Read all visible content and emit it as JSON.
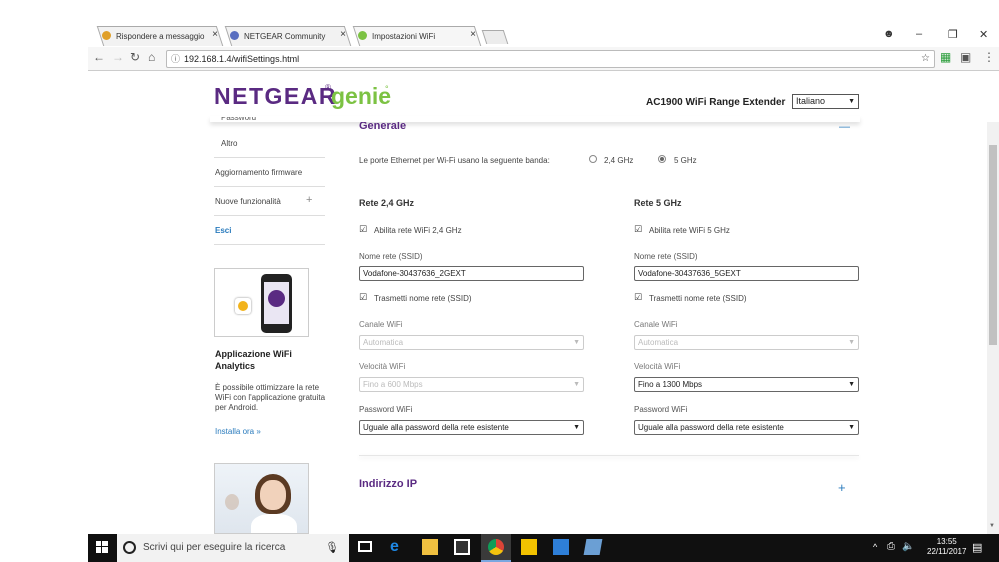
{
  "browser": {
    "tabs": [
      {
        "label": "Rispondere a messaggio",
        "favcolor": "#e0a02a"
      },
      {
        "label": "NETGEAR Community",
        "favcolor": "#5a6fc0"
      },
      {
        "label": "Impostazioni WiFi",
        "favcolor": "#7cc243"
      }
    ],
    "url": "192.168.1.4/wifiSettings.html"
  },
  "header": {
    "logo_brand": "NETGEAR",
    "logo_reg": "®",
    "logo_product": "genie",
    "logo_dot": "°",
    "model": "AC1900 WiFi Range Extender",
    "language": "Italiano"
  },
  "sidebar": {
    "cut_item": "Password",
    "items": [
      {
        "label": "Altro"
      },
      {
        "label": "Aggiornamento firmware"
      },
      {
        "label": "Nuove funzionalità"
      },
      {
        "label": "Esci"
      }
    ],
    "promo": {
      "title": "Applicazione WiFi Analytics",
      "body": "È possibile ottimizzare la rete WiFi con l'applicazione gratuita per Android.",
      "link": "Installa ora »"
    }
  },
  "main": {
    "general_title": "Generale",
    "collapse_symbol": "—",
    "ethernet_label": "Le porte Ethernet per Wi-Fi usano la seguente banda:",
    "band_options": [
      "2,4 GHz",
      "5 GHz"
    ],
    "band_selected": "5 GHz",
    "band24": {
      "title": "Rete 2,4 GHz",
      "enable_label": "Abilita rete WiFi 2,4 GHz",
      "ssid_label": "Nome rete (SSID)",
      "ssid_value": "Vodafone-30437636_2GEXT",
      "broadcast_label": "Trasmetti nome rete (SSID)",
      "channel_label": "Canale WiFi",
      "channel_value": "Automatica",
      "speed_label": "Velocità WiFi",
      "speed_value": "Fino a 600 Mbps",
      "password_label": "Password WiFi",
      "password_value": "Uguale alla password della rete esistente"
    },
    "band5": {
      "title": "Rete 5 GHz",
      "enable_label": "Abilita rete WiFi 5 GHz",
      "ssid_label": "Nome rete (SSID)",
      "ssid_value": "Vodafone-30437636_5GEXT",
      "broadcast_label": "Trasmetti nome rete (SSID)",
      "channel_label": "Canale WiFi",
      "channel_value": "Automatica",
      "speed_label": "Velocità WiFi",
      "speed_value": "Fino a 1300 Mbps",
      "password_label": "Password WiFi",
      "password_value": "Uguale alla password della rete esistente"
    },
    "ip_title": "Indirizzo IP",
    "expand_symbol": "+"
  },
  "taskbar": {
    "search_placeholder": "Scrivi qui per eseguire la ricerca",
    "time": "13:55",
    "date": "22/11/2017"
  }
}
